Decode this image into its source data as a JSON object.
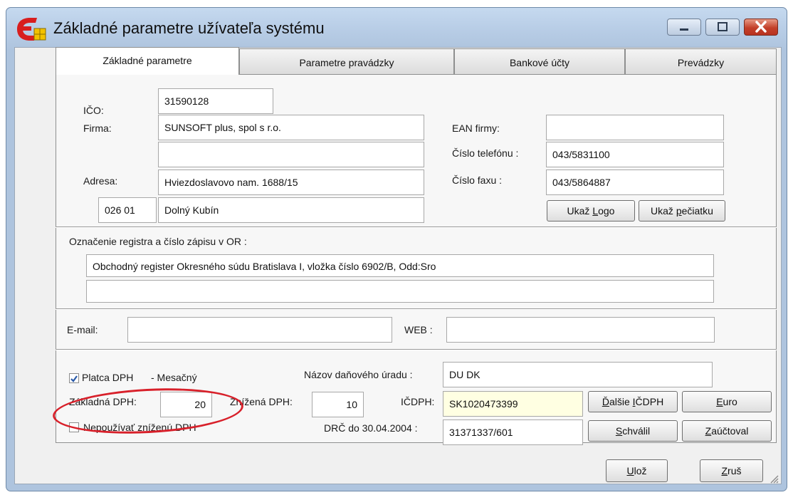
{
  "window": {
    "title": "Základné parametre užívateľa systému"
  },
  "tabs": [
    {
      "label": "Základné parametre",
      "active": true
    },
    {
      "label": "Parametre pravádzky",
      "active": false
    },
    {
      "label": "Bankové účty",
      "active": false
    },
    {
      "label": "Prevádzky",
      "active": false
    }
  ],
  "company": {
    "ico_label": "IČO:",
    "ico_value": "31590128",
    "firma_label": "Firma:",
    "firma_value": "SUNSOFT plus, spol s r.o.",
    "firma_value2": "",
    "adresa_label": "Adresa:",
    "adresa_value": "Hviezdoslavovo nam. 1688/15",
    "psc_value": "026 01",
    "mesto_value": "Dolný Kubín",
    "ean_label": "EAN firmy:",
    "ean_value": "",
    "telefon_label": "Číslo telefónu :",
    "telefon_value": "043/5831100",
    "fax_label": "Číslo faxu :",
    "fax_value": "043/5864887",
    "logo_button": {
      "label": "Ukaž Logo",
      "shortcut": "L"
    },
    "peciatka_button": {
      "label": "Ukaž pečiatku",
      "shortcut": "p"
    }
  },
  "register": {
    "label": "Označenie registra a číslo zápisu v OR :",
    "line1": "Obchodný register Okresného súdu Bratislava I, vložka číslo 6902/B, Odd:Sro",
    "line2": ""
  },
  "contact": {
    "email_label": "E-mail:",
    "email_value": "",
    "web_label": "WEB :",
    "web_value": ""
  },
  "tax": {
    "platca_checked": true,
    "platca_label": "Platca DPH",
    "platca_period": "- Mesačný",
    "zakladna_label": "Základná  DPH:",
    "zakladna_value": "20",
    "znizena_label": "Znížená  DPH:",
    "znizena_value": "10",
    "nepouzivat_checked": false,
    "nepouzivat_label": "Nepoužívať zníženú DPH",
    "urad_label": "Názov daňového úradu :",
    "urad_value": "DU DK",
    "icdph_label": "IČDPH:",
    "icdph_value": "SK1020473399",
    "drc_label": "DRČ do 30.04.2004 :",
    "drc_value": "31371337/601",
    "dalsie_button": "Ďalšie IČDPH",
    "euro_button": "Euro",
    "schvalil_button": "Schválil",
    "zauctoval_button": "Zaúčtoval"
  },
  "footer": {
    "uloz_button": "Ulož",
    "zrus_button": "Zruš"
  },
  "colors": {
    "highlight_oval": "#d8202a",
    "icdph_field_bg": "#ffffe2"
  }
}
